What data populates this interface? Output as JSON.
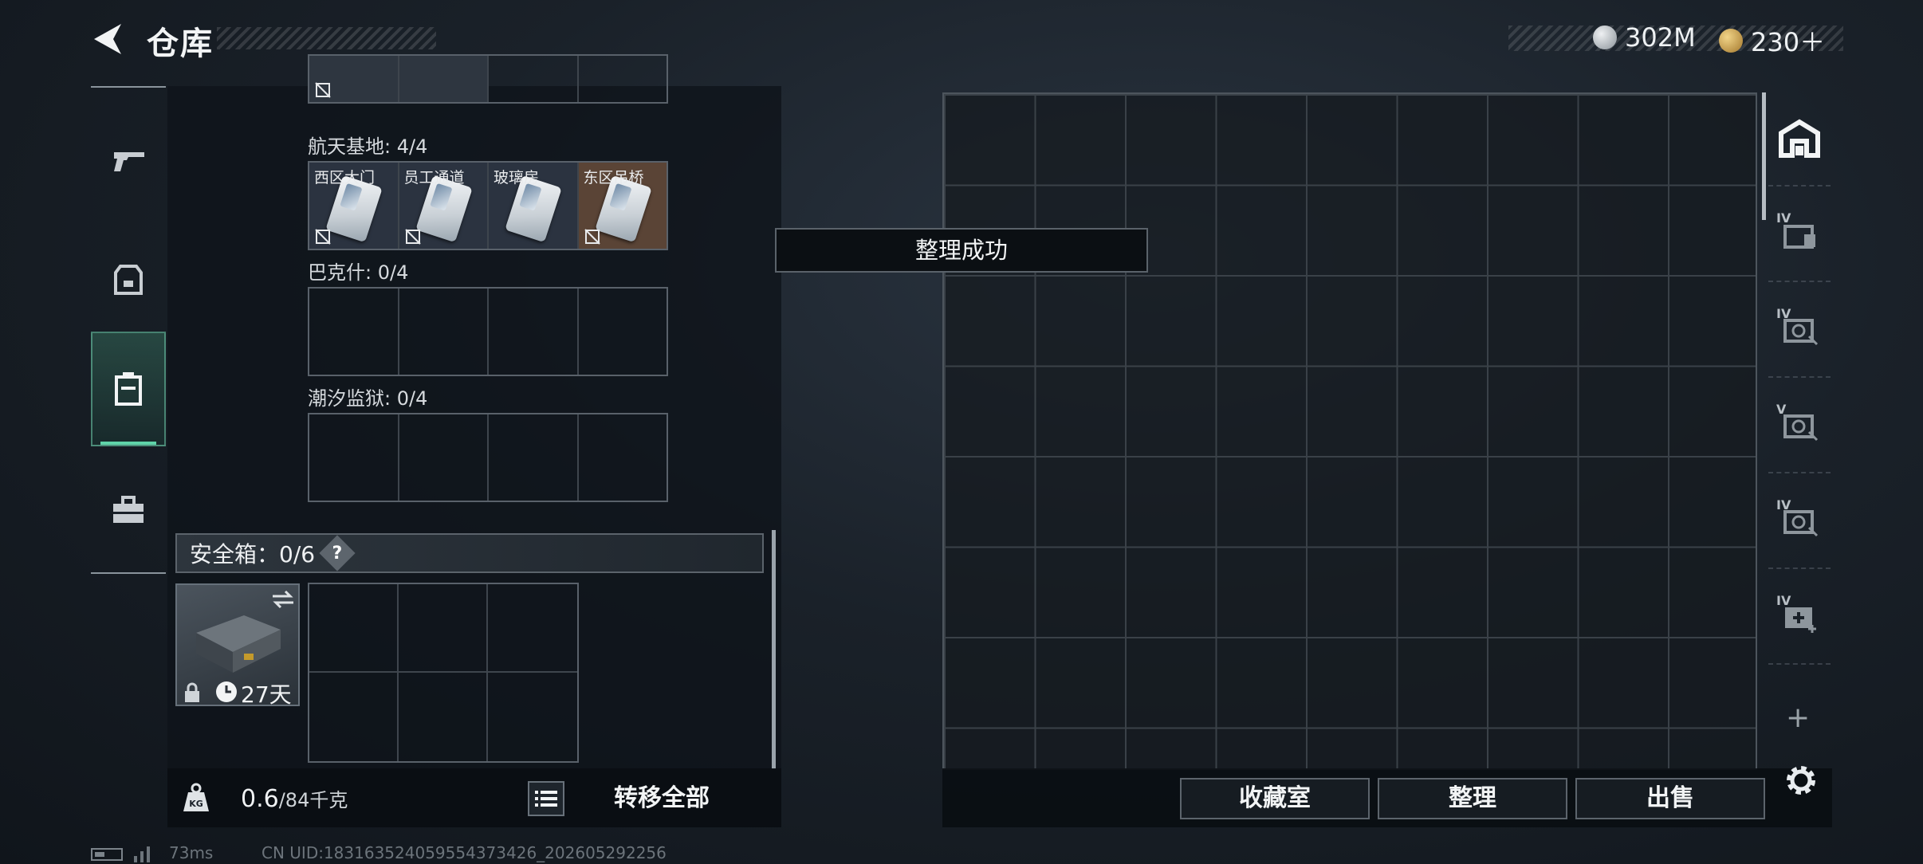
{
  "header": {
    "title": "仓库"
  },
  "currency": {
    "silver": "302M",
    "gold": "230＋"
  },
  "left_tabs": [
    "pistol-icon",
    "backpack-icon",
    "locker-icon",
    "toolbox-icon"
  ],
  "key_sections": [
    {
      "label": "航天基地: 4/4",
      "cells": [
        "西区大门",
        "员工通道",
        "玻璃房",
        "东区吊桥"
      ]
    },
    {
      "label": "巴克什: 0/4",
      "cells": []
    },
    {
      "label": "潮汐监狱: 0/4",
      "cells": []
    }
  ],
  "safe_box": {
    "label": "安全箱：0/6",
    "help": "?",
    "timer": "27天"
  },
  "weight": {
    "current": "0.6",
    "max": "/84千克"
  },
  "transfer_all": "转移全部",
  "toast": "整理成功",
  "right_buttons": {
    "collection": "收藏室",
    "organize": "整理",
    "sell": "出售"
  },
  "right_tabs": [
    {
      "name": "main-storage-icon",
      "level": ""
    },
    {
      "name": "storage-expansion-icon",
      "level": "IV"
    },
    {
      "name": "safe-storage-icon",
      "level": "IV"
    },
    {
      "name": "safe-storage-icon",
      "level": "V"
    },
    {
      "name": "safe-storage-icon",
      "level": "IV"
    },
    {
      "name": "medical-storage-icon",
      "level": "IV"
    }
  ],
  "status_bar": {
    "ping": "73ms",
    "uid": "CN UID:18316352405955437342​6_202605292256"
  },
  "colors": {
    "accent": "#5fd3a9",
    "key_rare": "#6a4a3a"
  }
}
